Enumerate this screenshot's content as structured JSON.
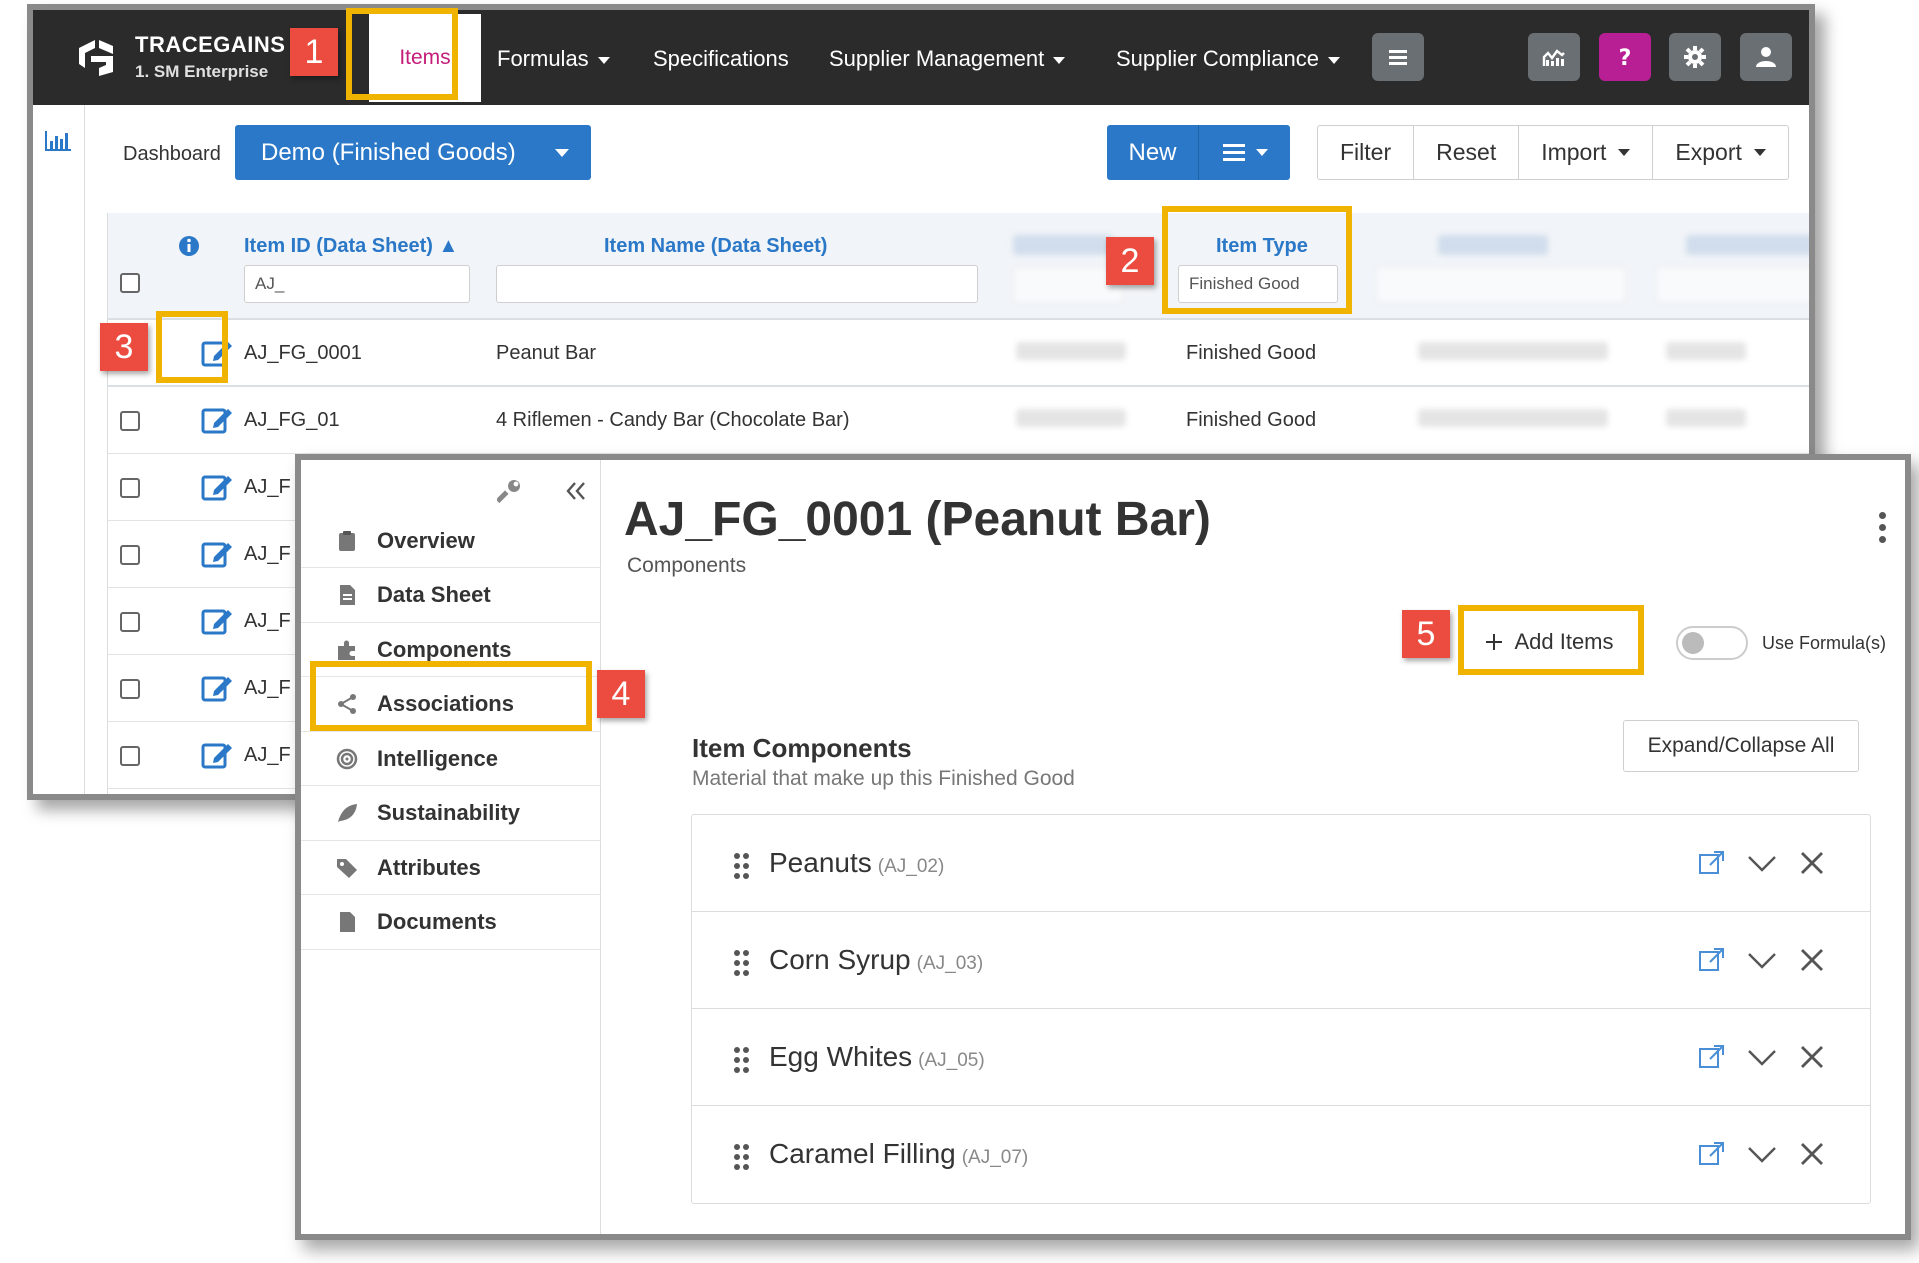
{
  "app": {
    "brand": "TRACEGAINS",
    "account": "1. SM Enterprise"
  },
  "nav": {
    "items": "Items",
    "formulas": "Formulas",
    "specifications": "Specifications",
    "supplier_management": "Supplier Management",
    "supplier_compliance": "Supplier Compliance"
  },
  "toolbar": {
    "dashboard_label": "Dashboard",
    "view_selected": "Demo (Finished Goods)",
    "new_label": "New",
    "filter_label": "Filter",
    "reset_label": "Reset",
    "import_label": "Import",
    "export_label": "Export"
  },
  "grid": {
    "col_item_id": "Item ID (Data Sheet) ▲",
    "col_item_name": "Item Name (Data Sheet)",
    "col_item_type": "Item Type",
    "filter_item_id": "AJ_",
    "filter_item_type": "Finished Good",
    "rows": [
      {
        "id": "AJ_FG_0001",
        "name": "Peanut Bar",
        "type": "Finished Good"
      },
      {
        "id": "AJ_FG_01",
        "name": "4 Riflemen - Candy Bar (Chocolate Bar)",
        "type": "Finished Good"
      },
      {
        "id": "AJ_F"
      },
      {
        "id": "AJ_F"
      },
      {
        "id": "AJ_F"
      },
      {
        "id": "AJ_F"
      },
      {
        "id": "AJ_F"
      }
    ]
  },
  "detail": {
    "title": "AJ_FG_0001 (Peanut Bar)",
    "subtitle": "Components",
    "add_items_label": "Add Items",
    "use_formula_label": "Use Formula(s)",
    "section_title": "Item Components",
    "section_desc": "Material that make up this Finished Good",
    "expand_label": "Expand/Collapse All",
    "sidebar": [
      {
        "label": "Overview",
        "icon": "clipboard-icon"
      },
      {
        "label": "Data Sheet",
        "icon": "file-text-icon"
      },
      {
        "label": "Components",
        "icon": "puzzle-icon"
      },
      {
        "label": "Associations",
        "icon": "share-icon"
      },
      {
        "label": "Intelligence",
        "icon": "intelligence-icon"
      },
      {
        "label": "Sustainability",
        "icon": "leaf-icon"
      },
      {
        "label": "Attributes",
        "icon": "tag-icon"
      },
      {
        "label": "Documents",
        "icon": "document-icon"
      }
    ],
    "components": [
      {
        "name": "Peanuts",
        "code": "(AJ_02)"
      },
      {
        "name": "Corn Syrup",
        "code": "(AJ_03)"
      },
      {
        "name": "Egg Whites",
        "code": "(AJ_05)"
      },
      {
        "name": "Caramel Filling",
        "code": "(AJ_07)"
      }
    ]
  },
  "callouts": [
    "1",
    "2",
    "3",
    "4",
    "5"
  ],
  "colors": {
    "accent_blue": "#2a78c7",
    "active_magenta": "#c41c79",
    "highlight": "#f0b400",
    "callout_red": "#ec4c3f",
    "topbar": "#2b2b2b"
  }
}
